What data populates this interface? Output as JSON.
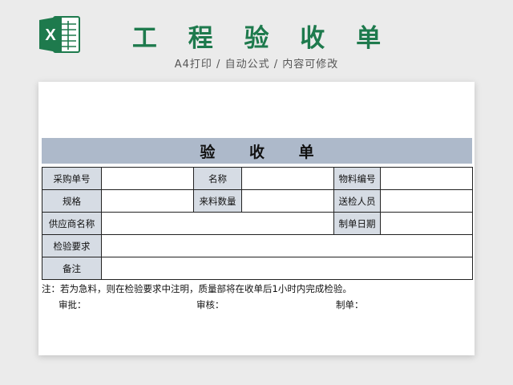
{
  "header": {
    "title": "工 程 验 收 单",
    "subtitle": "A4打印 / 自动公式 / 内容可修改"
  },
  "logo": {
    "icon": "excel-icon",
    "letter": "X",
    "brand_color": "#1e7a4d"
  },
  "form": {
    "title": "验 收 单",
    "rows": [
      {
        "l1": "采购单号",
        "l2": "名称",
        "l3": "物料编号"
      },
      {
        "l1": "规格",
        "l2": "来料数量",
        "l3": "送检人员"
      },
      {
        "l1": "供应商名称",
        "l3": "制单日期"
      },
      {
        "l1": "检验要求"
      },
      {
        "l1": "备注"
      }
    ],
    "note": "注：若为急料，则在检验要求中注明，质量部将在收单后1小时内完成检验。",
    "signatures": {
      "approve": "审批：",
      "review": "审核：",
      "prepare": "制单："
    }
  },
  "colors": {
    "title_bar": "#adb9ca",
    "label_cell": "#d6dce4",
    "heading_green": "#1e7a4d"
  }
}
